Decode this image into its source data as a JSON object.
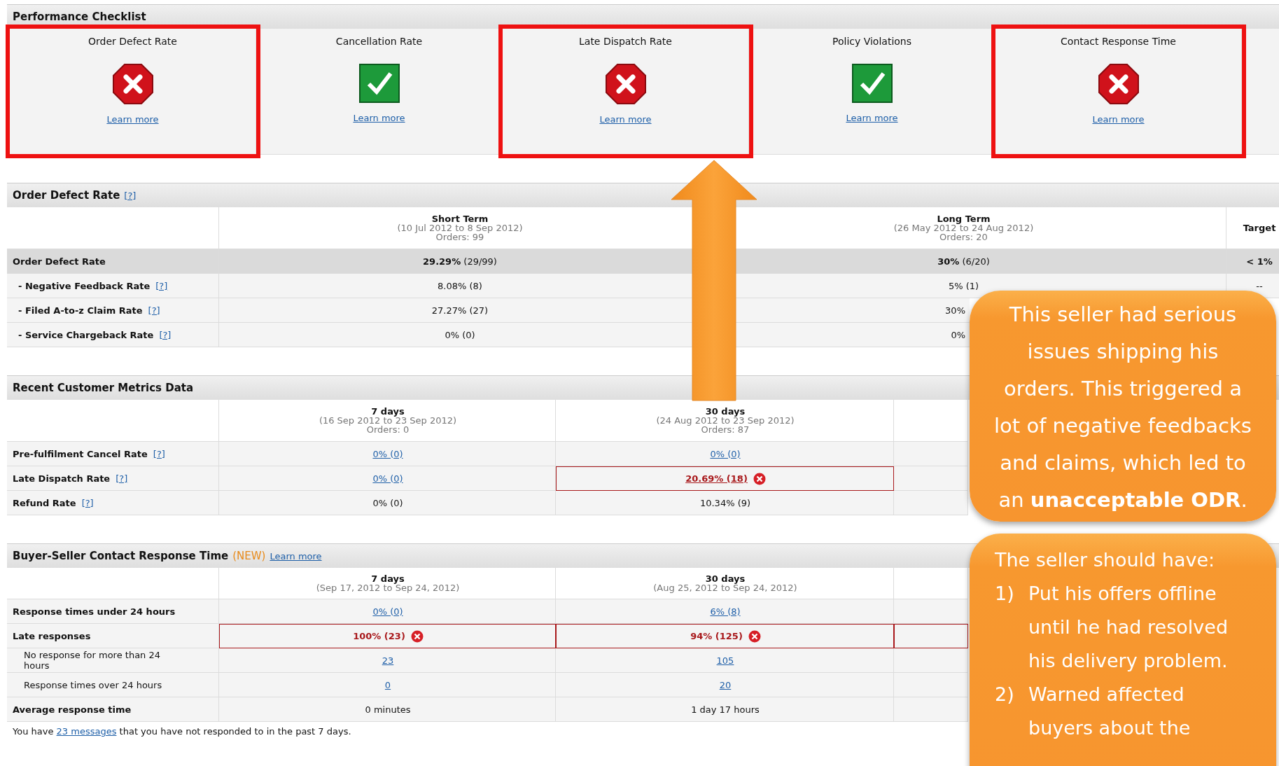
{
  "checklist": {
    "title": "Performance Checklist",
    "items": [
      {
        "label": "Order Defect Rate",
        "passed": false,
        "link": "Learn more",
        "highlighted": true
      },
      {
        "label": "Cancellation Rate",
        "passed": true,
        "link": "Learn more",
        "highlighted": false
      },
      {
        "label": "Late Dispatch Rate",
        "passed": false,
        "link": "Learn more",
        "highlighted": true
      },
      {
        "label": "Policy Violations",
        "passed": true,
        "link": "Learn more",
        "highlighted": false
      },
      {
        "label": "Contact Response Time",
        "passed": false,
        "link": "Learn more",
        "highlighted": true
      }
    ]
  },
  "odr": {
    "title": "Order Defect Rate",
    "help": "[?]",
    "columns": [
      {
        "title": "Short Term",
        "range": "(10 Jul 2012 to 8 Sep 2012)",
        "orders": "Orders: 99"
      },
      {
        "title": "Long Term",
        "range": "(26 May 2012 to 24 Aug 2012)",
        "orders": "Orders: 20"
      },
      {
        "title": "Target"
      }
    ],
    "rows": [
      {
        "label": "Order Defect Rate",
        "kind": "summary",
        "cells": [
          {
            "text": "**29.29%** (29/99)"
          },
          {
            "text": "**30%** (6/20)"
          },
          {
            "text": "< 1%",
            "bold": true
          }
        ]
      },
      {
        "label": "- Negative Feedback Rate",
        "help": "[?]",
        "kind": "sub",
        "cells": [
          {
            "text": "8.08% (8)"
          },
          {
            "text": "5% (1)"
          },
          {
            "text": "--"
          }
        ]
      },
      {
        "label": "- Filed A-to-z Claim Rate",
        "help": "[?]",
        "kind": "sub",
        "cells": [
          {
            "text": "27.27% (27)"
          },
          {
            "text": "30%",
            "partial": true
          }
        ]
      },
      {
        "label": "- Service Chargeback Rate",
        "help": "[?]",
        "kind": "sub",
        "cells": [
          {
            "text": "0% (0)"
          },
          {
            "text": "0%",
            "partial": true
          }
        ]
      }
    ]
  },
  "recent": {
    "title": "Recent Customer Metrics Data",
    "columns": [
      {
        "title": "7 days",
        "range": "(16 Sep 2012 to 23 Sep 2012)",
        "orders": "Orders: 0"
      },
      {
        "title": "30 days",
        "range": "(24 Aug 2012 to 23 Sep 2012)",
        "orders": "Orders: 87"
      }
    ],
    "rows": [
      {
        "label": "Pre-fulfilment Cancel Rate",
        "help": "[?]",
        "kind": "main",
        "cells": [
          {
            "text": "0% (0)",
            "link": true
          },
          {
            "text": "0% (0)",
            "link": true
          }
        ]
      },
      {
        "label": "Late Dispatch Rate",
        "help": "[?]",
        "kind": "main",
        "cells": [
          {
            "text": "0% (0)",
            "link": true
          },
          {
            "text": "20.69% (18)",
            "link": true,
            "alert": true
          }
        ]
      },
      {
        "label": "Refund Rate",
        "help": "[?]",
        "kind": "main",
        "cells": [
          {
            "text": "0% (0)"
          },
          {
            "text": "10.34% (9)"
          }
        ]
      }
    ]
  },
  "contact": {
    "title": "Buyer-Seller Contact Response Time",
    "badge": "(NEW)",
    "link": "Learn more",
    "columns": [
      {
        "title": "7 days",
        "range": "(Sep 17, 2012 to Sep 24, 2012)"
      },
      {
        "title": "30 days",
        "range": "(Aug 25, 2012 to Sep 24, 2012)"
      }
    ],
    "rows": [
      {
        "label": "Response times under 24 hours",
        "kind": "main",
        "cells": [
          {
            "text": "0% (0)",
            "link": true
          },
          {
            "text": "6% (8)",
            "link": true
          }
        ]
      },
      {
        "label": "Late responses",
        "kind": "main",
        "cells": [
          {
            "text": "100% (23)",
            "alert": true
          },
          {
            "text": "94% (125)",
            "alert": true
          },
          {
            "alert": true
          }
        ]
      },
      {
        "label": "No response for more than 24 hours",
        "kind": "detail",
        "cells": [
          {
            "text": "23",
            "link": true
          },
          {
            "text": "105",
            "link": true
          }
        ]
      },
      {
        "label": "Response times over 24 hours",
        "kind": "detail",
        "cells": [
          {
            "text": "0",
            "link": true
          },
          {
            "text": "20",
            "link": true
          }
        ]
      },
      {
        "label": "Average response time",
        "kind": "main",
        "cells": [
          {
            "text": "0 minutes"
          },
          {
            "text": "1 day 17 hours"
          }
        ]
      }
    ],
    "footer": {
      "before": "You have ",
      "link": "23 messages",
      "after": " that you have not responded to in the past 7 days."
    }
  },
  "callouts": [
    {
      "kind": "note",
      "text": "This seller had serious issues shipping his orders. This triggered a lot of negative feedbacks and claims, which led to an **unacceptable ODR**."
    },
    {
      "kind": "list",
      "intro": "The seller should have:",
      "items": [
        {
          "num": "1)",
          "text": "Put his offers offline until he had resolved his delivery problem."
        },
        {
          "num": "2)",
          "text": "Warned affected buyers about the"
        }
      ]
    }
  ]
}
